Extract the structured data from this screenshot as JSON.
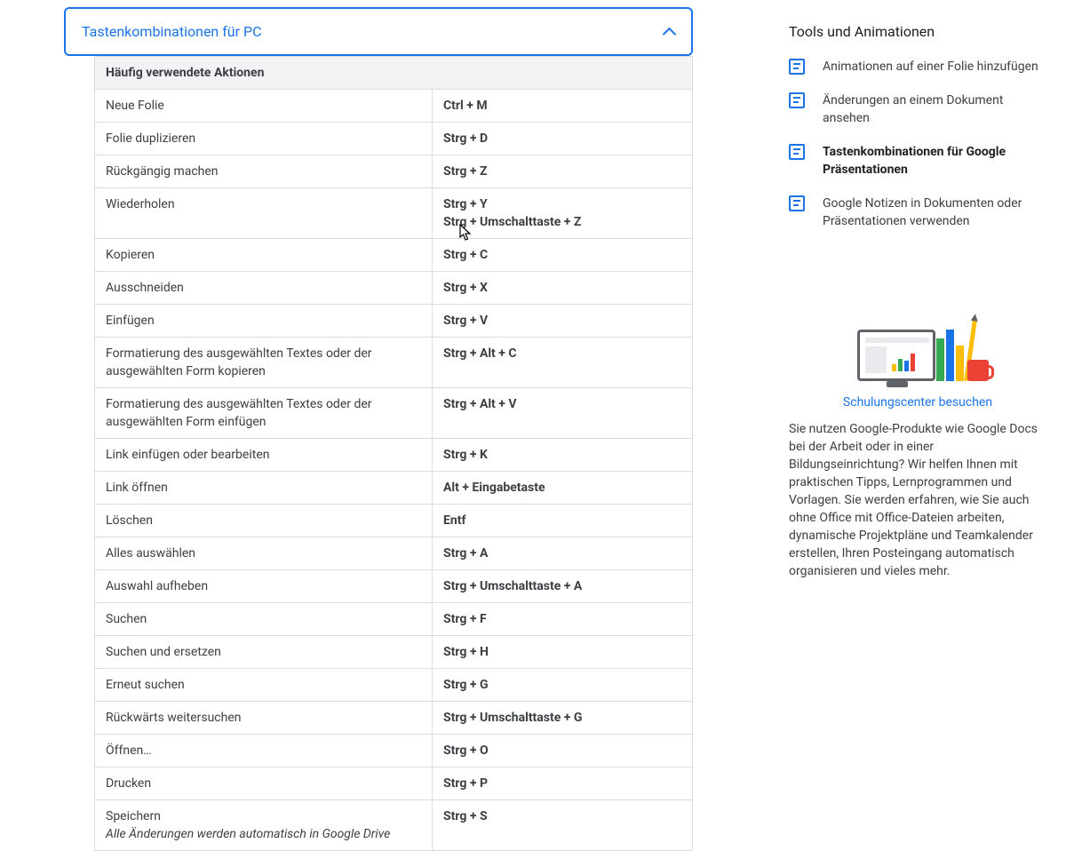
{
  "accordion": {
    "title": "Tastenkombinationen für PC"
  },
  "table": {
    "header": "Häufig verwendete Aktionen",
    "rows": [
      {
        "action": "Neue Folie",
        "shortcut": "Ctrl + M"
      },
      {
        "action": "Folie duplizieren",
        "shortcut": "Strg + D"
      },
      {
        "action": "Rückgängig machen",
        "shortcut": "Strg + Z"
      },
      {
        "action": "Wiederholen",
        "shortcut": "Strg + Y\nStrg + Umschalttaste + Z"
      },
      {
        "action": "Kopieren",
        "shortcut": "Strg + C"
      },
      {
        "action": "Ausschneiden",
        "shortcut": "Strg + X"
      },
      {
        "action": "Einfügen",
        "shortcut": "Strg + V"
      },
      {
        "action": "Formatierung des ausgewählten Textes oder der ausgewählten Form kopieren",
        "shortcut": "Strg + Alt + C"
      },
      {
        "action": "Formatierung des ausgewählten Textes oder der ausgewählten Form einfügen",
        "shortcut": "Strg + Alt + V"
      },
      {
        "action": "Link einfügen oder bearbeiten",
        "shortcut": "Strg + K"
      },
      {
        "action": "Link öffnen",
        "shortcut": "Alt + Eingabetaste"
      },
      {
        "action": "Löschen",
        "shortcut": "Entf"
      },
      {
        "action": "Alles auswählen",
        "shortcut": "Strg + A"
      },
      {
        "action": "Auswahl aufheben",
        "shortcut": "Strg + Umschalttaste + A"
      },
      {
        "action": "Suchen",
        "shortcut": "Strg + F"
      },
      {
        "action": "Suchen und ersetzen",
        "shortcut": "Strg + H"
      },
      {
        "action": "Erneut suchen",
        "shortcut": "Strg + G"
      },
      {
        "action": "Rückwärts weitersuchen",
        "shortcut": "Strg + Umschalttaste + G"
      },
      {
        "action": "Öffnen…",
        "shortcut": "Strg + O"
      },
      {
        "action": "Drucken",
        "shortcut": "Strg + P"
      },
      {
        "action": "Speichern",
        "note": "Alle Änderungen werden automatisch in Google Drive",
        "shortcut": "Strg + S"
      }
    ]
  },
  "sidebar": {
    "title": "Tools und Animationen",
    "items": [
      {
        "label": "Animationen auf einer Folie hinzufügen",
        "active": false
      },
      {
        "label": "Änderungen an einem Dokument ansehen",
        "active": false
      },
      {
        "label": "Tastenkombinationen für Google Präsentationen",
        "active": true
      },
      {
        "label": "Google Notizen in Dokumenten oder Präsentationen verwenden",
        "active": false
      }
    ],
    "promo": {
      "link": "Schulungscenter besuchen",
      "text": "Sie nutzen Google-Produkte wie Google Docs bei der Arbeit oder in einer Bildungseinrichtung? Wir helfen Ihnen mit praktischen Tipps, Lernprogrammen und Vorlagen. Sie werden erfahren, wie Sie auch ohne Office mit Office-Dateien arbeiten, dynamische Projektpläne und Teamkalender erstellen, Ihren Posteingang automatisch organisieren und vieles mehr."
    }
  }
}
